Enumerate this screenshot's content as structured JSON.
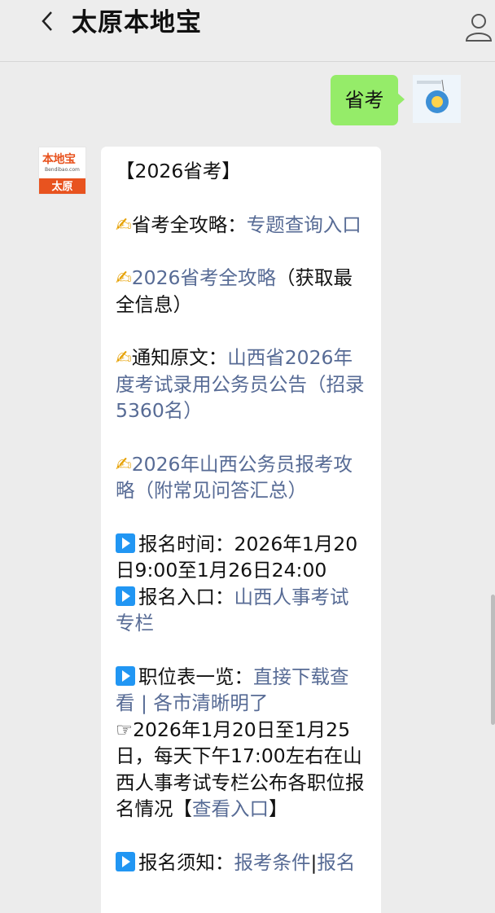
{
  "header": {
    "title": "太原本地宝"
  },
  "outgoing": {
    "text": "省考"
  },
  "bot_avatar": {
    "logo_main": "本地宝",
    "logo_sub": "Bendibao.com",
    "logo_city": "太原"
  },
  "message": {
    "heading": "【2026省考】",
    "items": [
      {
        "icon": "pen-icon",
        "prefix": "省考全攻略：",
        "link": "专题查询入口",
        "suffix": ""
      },
      {
        "icon": "pen-icon",
        "prefix": "",
        "link": "2026省考全攻略",
        "suffix": "（获取最全信息）"
      },
      {
        "icon": "pen-icon",
        "prefix": "通知原文：",
        "link": "山西省2026年度考试录用公务员公告（招录5360名）",
        "suffix": ""
      },
      {
        "icon": "pen-icon",
        "prefix": "",
        "link": "2026年山西公务员报考攻略（附常见问答汇总）",
        "suffix": ""
      }
    ],
    "signup_time_label": "报名时间：",
    "signup_time_value": "2026年1月20日9:00至1月26日24:00",
    "signup_entry_label": "报名入口：",
    "signup_entry_link": "山西人事考试专栏",
    "positions_label": "职位表一览：",
    "positions_link1": "直接下载查看",
    "positions_sep": " | ",
    "positions_link2": "各市清晰明了",
    "notice_prefix": "☞2026年1月20日至1月25日，每天下午17:00左右在山西人事考试专栏公布各职位报名情况【",
    "notice_link": "查看入口",
    "notice_suffix": "】",
    "rules_label": "报名须知：",
    "rules_link1": "报考条件",
    "rules_sep": "|",
    "rules_link2": "报名"
  },
  "colors": {
    "link": "#576b95",
    "outgoing_bubble": "#95ec69",
    "background": "#ececec",
    "brand_orange": "#e8531f"
  }
}
